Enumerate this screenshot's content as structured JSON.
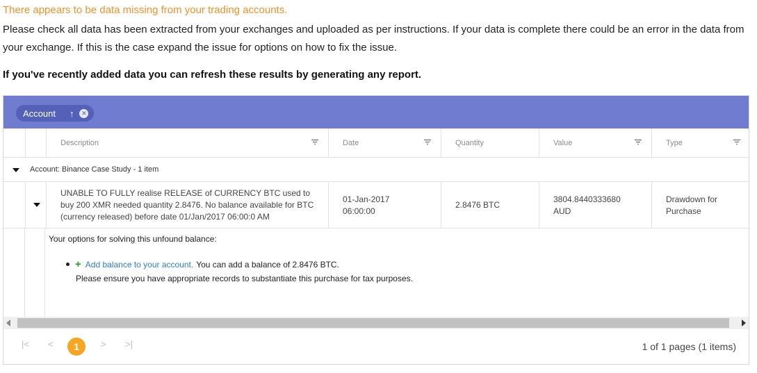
{
  "warning": "There appears to be data missing from your trading accounts.",
  "instructions": "Please check all data has been extracted from your exchanges and uploaded as per instructions. If your data is complete there could be an error in the data from your exchange. If this is the case expand the issue for options on how to fix the issue.",
  "refresh_note": "If you've recently added data you can refresh these results by generating any report.",
  "grid": {
    "group_chip": {
      "label": "Account",
      "sort_glyph": "↑",
      "close_glyph": "✕"
    },
    "columns": [
      "Description",
      "Date",
      "Quantity",
      "Value",
      "Type"
    ],
    "group_row": "Account: Binance Case Study - 1 item",
    "row": {
      "description": "UNABLE TO FULLY realise RELEASE of CURRENCY BTC used to buy 200 XMR needed quantity 2.8476. No balance available for BTC (currency released) before date 01/Jan/2017 06:00:0 AM",
      "date": "01-Jan-2017 06:00:00",
      "quantity": "2.8476 BTC",
      "value": "3804.8440333680 AUD",
      "type": "Drawdown for Purchase"
    },
    "detail": {
      "title": "Your options for solving this unfound balance:",
      "option_icon": "+",
      "option_link": "Add balance to your account.",
      "option_text": "You can add a balance of 2.8476 BTC.",
      "note": "Please ensure you have appropriate records to substantiate this purchase for tax purposes."
    },
    "pager": {
      "first": "|<",
      "prev": "<",
      "current_page": "1",
      "next": ">",
      "last": ">|",
      "info": "1 of 1 pages (1 items)"
    }
  },
  "colors": {
    "warning": "#f0922a",
    "group_bar": "#6f7ccf",
    "chip": "#5361b8",
    "link": "#2a7fc2",
    "plus": "#2a9b2a",
    "page_active": "#f6a623"
  }
}
